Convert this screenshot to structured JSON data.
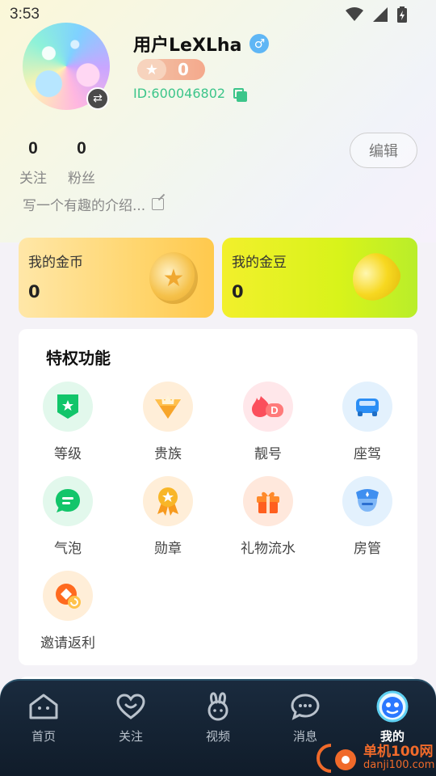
{
  "status_bar": {
    "time": "3:53"
  },
  "profile": {
    "username": "用户LeXLha",
    "gender_symbol": "♂",
    "level": "0",
    "user_id": "ID:600046802",
    "stats": [
      {
        "value": "0",
        "label": "关注"
      },
      {
        "value": "0",
        "label": "粉丝"
      }
    ],
    "edit_label": "编辑",
    "bio_placeholder": "写一个有趣的介绍..."
  },
  "wallet": {
    "coins": {
      "title": "我的金币",
      "value": "0"
    },
    "beans": {
      "title": "我的金豆",
      "value": "0"
    }
  },
  "privileges": {
    "title": "特权功能",
    "items": [
      {
        "label": "等级",
        "icon": "level-shield-icon"
      },
      {
        "label": "贵族",
        "icon": "crown-gem-icon"
      },
      {
        "label": "靓号",
        "icon": "pretty-id-icon"
      },
      {
        "label": "座驾",
        "icon": "car-icon"
      },
      {
        "label": "气泡",
        "icon": "chat-bubble-icon"
      },
      {
        "label": "勋章",
        "icon": "medal-icon"
      },
      {
        "label": "礼物流水",
        "icon": "gift-icon"
      },
      {
        "label": "房管",
        "icon": "room-manager-icon"
      },
      {
        "label": "邀请返利",
        "icon": "invite-rebate-icon"
      }
    ]
  },
  "tab_bar": {
    "tabs": [
      {
        "label": "首页",
        "icon": "home-icon"
      },
      {
        "label": "关注",
        "icon": "heart-face-icon"
      },
      {
        "label": "视频",
        "icon": "bunny-icon"
      },
      {
        "label": "消息",
        "icon": "message-icon"
      },
      {
        "label": "我的",
        "icon": "profile-face-icon",
        "active": true
      }
    ]
  },
  "watermark": {
    "line1": "单机100网",
    "line2": "danji100.com"
  },
  "colors": {
    "accent_green": "#3cc58a",
    "tab_bar_bg": "#142232",
    "coin_card": "#ffd66f",
    "bean_card": "#d8f31a"
  }
}
